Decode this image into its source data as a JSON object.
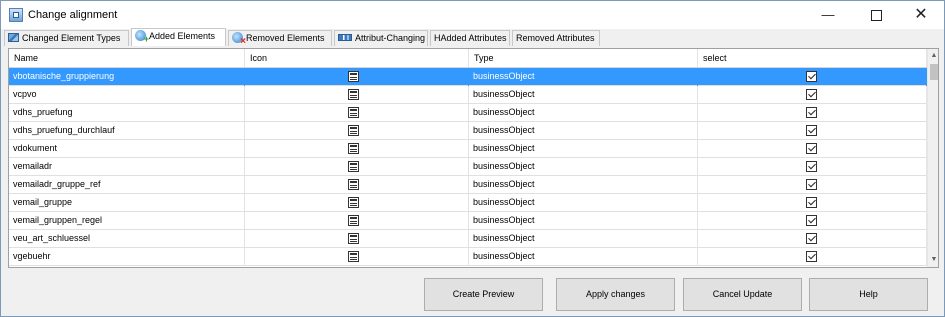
{
  "window": {
    "title": "Change alignment",
    "controls": {
      "minimize": "—",
      "close": "✕"
    }
  },
  "tabs": [
    {
      "label": "Changed Element Types",
      "icon": "element-types-icon",
      "active": false
    },
    {
      "label": "Added Elements",
      "icon": "globe-add-icon",
      "active": true
    },
    {
      "label": "Removed Elements",
      "icon": "globe-remove-icon",
      "active": false
    },
    {
      "label": "Attribut-Changing",
      "icon": "attribute-icon",
      "active": false
    },
    {
      "label": "HAdded Attributes",
      "icon": "",
      "active": false
    },
    {
      "label": "Removed Attributes",
      "icon": "",
      "active": false
    }
  ],
  "grid": {
    "columns": [
      "Name",
      "Icon",
      "Type",
      "select"
    ],
    "rows": [
      {
        "name": "vbotanische_gruppierung",
        "type": "businessObject",
        "selected": true,
        "checked": true
      },
      {
        "name": "vcpvo",
        "type": "businessObject",
        "selected": false,
        "checked": true
      },
      {
        "name": "vdhs_pruefung",
        "type": "businessObject",
        "selected": false,
        "checked": true
      },
      {
        "name": "vdhs_pruefung_durchlauf",
        "type": "businessObject",
        "selected": false,
        "checked": true
      },
      {
        "name": "vdokument",
        "type": "businessObject",
        "selected": false,
        "checked": true
      },
      {
        "name": "vemailadr",
        "type": "businessObject",
        "selected": false,
        "checked": true
      },
      {
        "name": "vemailadr_gruppe_ref",
        "type": "businessObject",
        "selected": false,
        "checked": true
      },
      {
        "name": "vemail_gruppe",
        "type": "businessObject",
        "selected": false,
        "checked": true
      },
      {
        "name": "vemail_gruppen_regel",
        "type": "businessObject",
        "selected": false,
        "checked": true
      },
      {
        "name": "veu_art_schluessel",
        "type": "businessObject",
        "selected": false,
        "checked": true
      },
      {
        "name": "vgebuehr",
        "type": "businessObject",
        "selected": false,
        "checked": true
      }
    ],
    "scroll": {
      "up": "▲",
      "down": "▼"
    }
  },
  "buttons": {
    "create_preview": "Create Preview",
    "apply_changes": "Apply changes",
    "cancel_update": "Cancel Update",
    "help": "Help"
  }
}
